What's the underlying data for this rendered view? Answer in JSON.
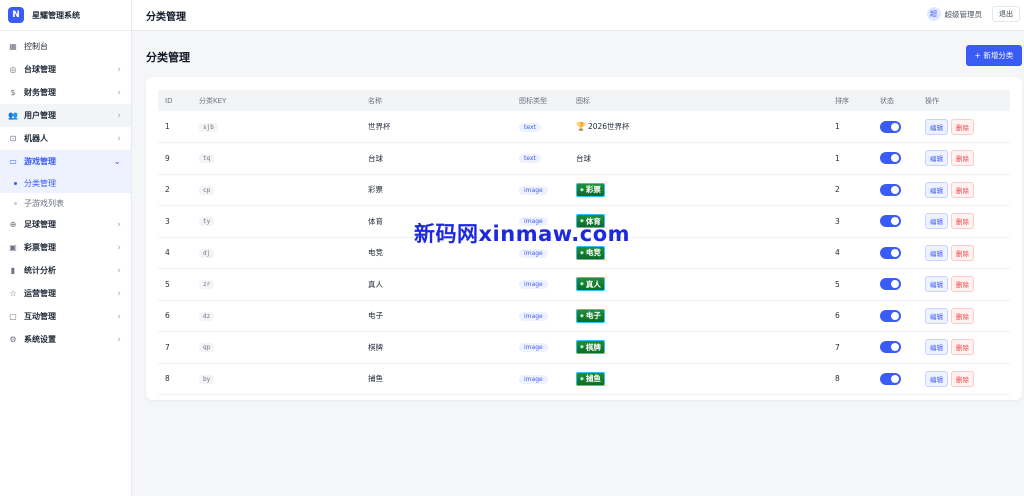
{
  "app": {
    "logo_letter": "N",
    "name": "星耀管理系统"
  },
  "sidebar": {
    "items": [
      {
        "label": "控制台",
        "icon": "grid-icon",
        "chevron": false,
        "plain": true
      },
      {
        "label": "台球管理",
        "icon": "billiard-icon",
        "chevron": true
      },
      {
        "label": "财务管理",
        "icon": "dollar-icon",
        "chevron": true
      },
      {
        "label": "用户管理",
        "icon": "users-icon",
        "chevron": true,
        "highlight": true
      },
      {
        "label": "机器人",
        "icon": "robot-icon",
        "chevron": true
      },
      {
        "label": "游戏管理",
        "icon": "monitor-icon",
        "chevron": true,
        "active": true,
        "expanded": true
      },
      {
        "label": "足球管理",
        "icon": "globe-icon",
        "chevron": true
      },
      {
        "label": "彩票管理",
        "icon": "ticket-icon",
        "chevron": true
      },
      {
        "label": "统计分析",
        "icon": "bar-chart-icon",
        "chevron": true
      },
      {
        "label": "运营管理",
        "icon": "star-icon",
        "chevron": true
      },
      {
        "label": "互动管理",
        "icon": "chat-icon",
        "chevron": true
      },
      {
        "label": "系统设置",
        "icon": "gear-icon",
        "chevron": true
      }
    ],
    "sub_items": [
      {
        "label": "分类管理",
        "active": true
      },
      {
        "label": "子游戏列表",
        "active": false
      }
    ]
  },
  "topbar": {
    "title": "分类管理",
    "avatar_text": "超",
    "user_name": "超级管理员",
    "logout_label": "退出"
  },
  "page": {
    "title": "分类管理",
    "add_button": "+ 新增分类"
  },
  "table": {
    "headers": [
      "ID",
      "分类KEY",
      "名称",
      "图标类型",
      "图标",
      "排序",
      "状态",
      "操作"
    ],
    "rows": [
      {
        "id": "1",
        "key": "sjb",
        "name": "世界杯",
        "icon_type": "text",
        "icon_kind": "text",
        "icon_value": "2026世界杯",
        "icon_prefix": "🏆",
        "sort": "1",
        "status_on": true
      },
      {
        "id": "9",
        "key": "tq",
        "name": "台球",
        "icon_type": "text",
        "icon_kind": "text",
        "icon_value": "台球",
        "icon_prefix": "",
        "sort": "1",
        "status_on": true
      },
      {
        "id": "2",
        "key": "cp",
        "name": "彩票",
        "icon_type": "image",
        "icon_kind": "image",
        "icon_value": "彩票",
        "sort": "2",
        "status_on": true
      },
      {
        "id": "3",
        "key": "ty",
        "name": "体育",
        "icon_type": "image",
        "icon_kind": "image",
        "icon_value": "体育",
        "sort": "3",
        "status_on": true
      },
      {
        "id": "4",
        "key": "dj",
        "name": "电竞",
        "icon_type": "image",
        "icon_kind": "image",
        "icon_value": "电竞",
        "sort": "4",
        "status_on": true
      },
      {
        "id": "5",
        "key": "zr",
        "name": "真人",
        "icon_type": "image",
        "icon_kind": "image",
        "icon_value": "真人",
        "sort": "5",
        "status_on": true
      },
      {
        "id": "6",
        "key": "dz",
        "name": "电子",
        "icon_type": "image",
        "icon_kind": "image",
        "icon_value": "电子",
        "sort": "6",
        "status_on": true
      },
      {
        "id": "7",
        "key": "qp",
        "name": "棋牌",
        "icon_type": "image",
        "icon_kind": "image",
        "icon_value": "棋牌",
        "sort": "7",
        "status_on": true
      },
      {
        "id": "8",
        "key": "by",
        "name": "捕鱼",
        "icon_type": "image",
        "icon_kind": "image",
        "icon_value": "捕鱼",
        "sort": "8",
        "status_on": true
      }
    ],
    "edit_label": "编辑",
    "delete_label": "删除"
  },
  "watermark": "新码网xinmaw.com",
  "colors": {
    "accent": "#3b5bf5",
    "danger": "#ef4444",
    "badge_green": "#1f8f3a"
  }
}
